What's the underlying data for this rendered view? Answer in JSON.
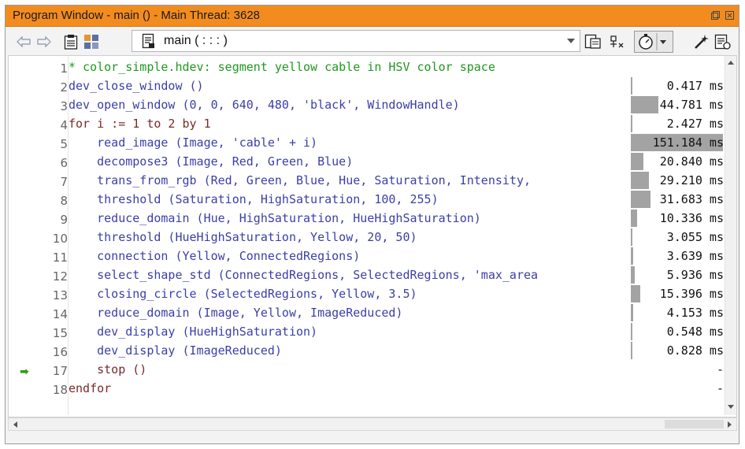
{
  "window": {
    "title": "Program Window - main () - Main Thread: 3628",
    "title_bar_color": "#f28c1f",
    "buttons": {
      "restore": "🗗",
      "close": "✕"
    }
  },
  "toolbar": {
    "icons": [
      "back-arrow-icon",
      "forward-arrow-icon",
      "clipboard-icon",
      "grid-icon",
      "procedure-icon",
      "templates-icon",
      "clear-breakpoints-icon",
      "profiler-icon",
      "magic-wand-icon",
      "report-icon"
    ],
    "procedure": "main ( : : : )"
  },
  "editor": {
    "lines": [
      {
        "n": "1",
        "text": "* color_simple.hdev: segment yellow cable in HSV color space",
        "kind": "cm",
        "time": ""
      },
      {
        "n": "2",
        "text": "dev_close_window ()",
        "kind": "op",
        "time": "0.417 ms"
      },
      {
        "n": "3",
        "text": "dev_open_window (0, 0, 640, 480, 'black', WindowHandle)",
        "kind": "op",
        "time": "44.781 ms"
      },
      {
        "n": "4",
        "text": "for i := 1 to 2 by 1",
        "kind": "kw",
        "time": "2.427 ms"
      },
      {
        "n": "5",
        "text": "    read_image (Image, 'cable' + i)",
        "kind": "op",
        "time": "151.184 ms"
      },
      {
        "n": "6",
        "text": "    decompose3 (Image, Red, Green, Blue)",
        "kind": "op",
        "time": "20.840 ms"
      },
      {
        "n": "7",
        "text": "    trans_from_rgb (Red, Green, Blue, Hue, Saturation, Intensity,",
        "kind": "op",
        "time": "29.210 ms"
      },
      {
        "n": "8",
        "text": "    threshold (Saturation, HighSaturation, 100, 255)",
        "kind": "op",
        "time": "31.683 ms"
      },
      {
        "n": "9",
        "text": "    reduce_domain (Hue, HighSaturation, HueHighSaturation)",
        "kind": "op",
        "time": "10.336 ms"
      },
      {
        "n": "10",
        "text": "    threshold (HueHighSaturation, Yellow, 20, 50)",
        "kind": "op",
        "time": "3.055 ms"
      },
      {
        "n": "11",
        "text": "    connection (Yellow, ConnectedRegions)",
        "kind": "op",
        "time": "3.639 ms"
      },
      {
        "n": "12",
        "text": "    select_shape_std (ConnectedRegions, SelectedRegions, 'max_area",
        "kind": "op",
        "time": "5.936 ms"
      },
      {
        "n": "13",
        "text": "    closing_circle (SelectedRegions, Yellow, 3.5)",
        "kind": "op",
        "time": "15.396 ms"
      },
      {
        "n": "14",
        "text": "    reduce_domain (Image, Yellow, ImageReduced)",
        "kind": "op",
        "time": "4.153 ms"
      },
      {
        "n": "15",
        "text": "    dev_display (HueHighSaturation)",
        "kind": "op",
        "time": "0.548 ms"
      },
      {
        "n": "16",
        "text": "    dev_display (ImageReduced)",
        "kind": "op",
        "time": "0.828 ms"
      },
      {
        "n": "17",
        "text": "    stop ()",
        "kind": "kw",
        "time": "-",
        "current": true
      },
      {
        "n": "18",
        "text": "endfor",
        "kind": "kw",
        "time": "-"
      }
    ],
    "pc_marker": "➡"
  },
  "colors": {
    "comment": "#1e9a1e",
    "operator": "#23238c",
    "keyword": "#7a2a2a",
    "profile_bar": "#a3a3a3"
  }
}
